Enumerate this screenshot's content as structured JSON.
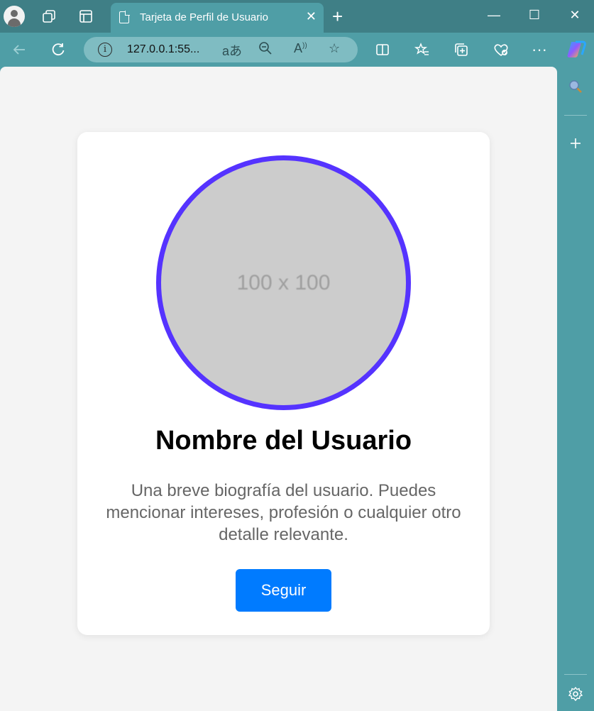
{
  "browser": {
    "tab": {
      "title": "Tarjeta de Perfil de Usuario",
      "close": "✕",
      "icon": "document-icon"
    },
    "new_tab": "+",
    "window_controls": {
      "minimize": "—",
      "maximize": "☐",
      "close": "✕"
    },
    "address_bar": {
      "url": "127.0.0.1:55..."
    },
    "icons": [
      "profile-avatar-icon",
      "workspaces-icon",
      "tab-actions-icon",
      "back-icon",
      "refresh-icon",
      "info-icon",
      "translate-icon",
      "zoom-out-icon",
      "read-aloud-icon",
      "favorite-star-icon",
      "split-screen-icon",
      "favorites-icon",
      "collections-icon",
      "browser-essentials-icon",
      "more-icon",
      "copilot-icon",
      "search-sidebar-icon",
      "add-sidebar-icon",
      "settings-gear-icon"
    ]
  },
  "profile_card": {
    "photo_placeholder": "100 x 100",
    "name": "Nombre del Usuario",
    "bio": "Una breve biografía del usuario. Puedes mencionar intereses, profesión o cualquier otro detalle relevante.",
    "follow_button": "Seguir"
  },
  "colors": {
    "photo_border": "#5533ff",
    "photo_fill": "#cccccc",
    "button": "#007bff",
    "browser_chrome": "#4f9ea6"
  }
}
